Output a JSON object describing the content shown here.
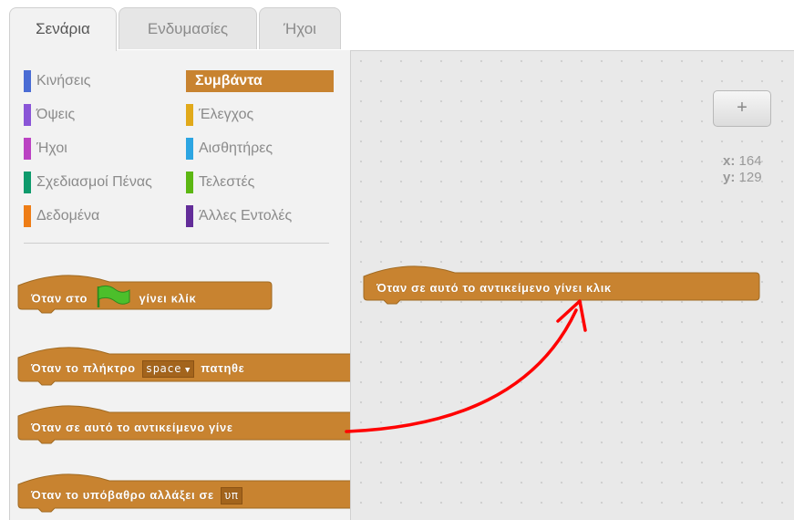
{
  "tabs": [
    {
      "label": "Σενάρια",
      "active": true
    },
    {
      "label": "Ενδυμασίες",
      "active": false
    },
    {
      "label": "Ήχοι",
      "active": false
    }
  ],
  "categories": [
    {
      "label": "Κινήσεις",
      "color": "#4a6cd4"
    },
    {
      "label": "Όψεις",
      "color": "#8a55d7"
    },
    {
      "label": "Ήχοι",
      "color": "#bb42c3"
    },
    {
      "label": "Σχεδιασμοί Πένας",
      "color": "#0e9a6c"
    },
    {
      "label": "Δεδομένα",
      "color": "#ee7d16"
    },
    {
      "label": "Συμβάντα",
      "color": "#c88330",
      "selected": true
    },
    {
      "label": "Έλεγχος",
      "color": "#e1a91a"
    },
    {
      "label": "Αισθητήρες",
      "color": "#2ca5e2"
    },
    {
      "label": "Τελεστές",
      "color": "#5cb712"
    },
    {
      "label": "Άλλες Εντολές",
      "color": "#632d99"
    }
  ],
  "palette_blocks": {
    "flag_block": {
      "before": "Όταν στο",
      "after": "γίνει κλίκ",
      "icon": "green-flag-icon"
    },
    "key_block": {
      "before": "Όταν το πλήκτρο",
      "dropdown": "space",
      "after": "πατηθε"
    },
    "sprite_click_block": {
      "text": "Όταν σε αυτό το αντικείμενο γίνε"
    },
    "backdrop_block": {
      "before": "Όταν το υπόβαθρο αλλάξει σε",
      "dropdown": "υπ"
    }
  },
  "script_area": {
    "block_text": "Όταν σε αυτό το αντικείμενο γίνει κλικ",
    "zoom_label": "+",
    "x_label": "x:",
    "x_value": "164",
    "y_label": "y:",
    "y_value": "129"
  },
  "colors": {
    "event_block": "#c88330",
    "event_block_border": "#a06a22",
    "annotation_arrow": "#ff0000"
  }
}
